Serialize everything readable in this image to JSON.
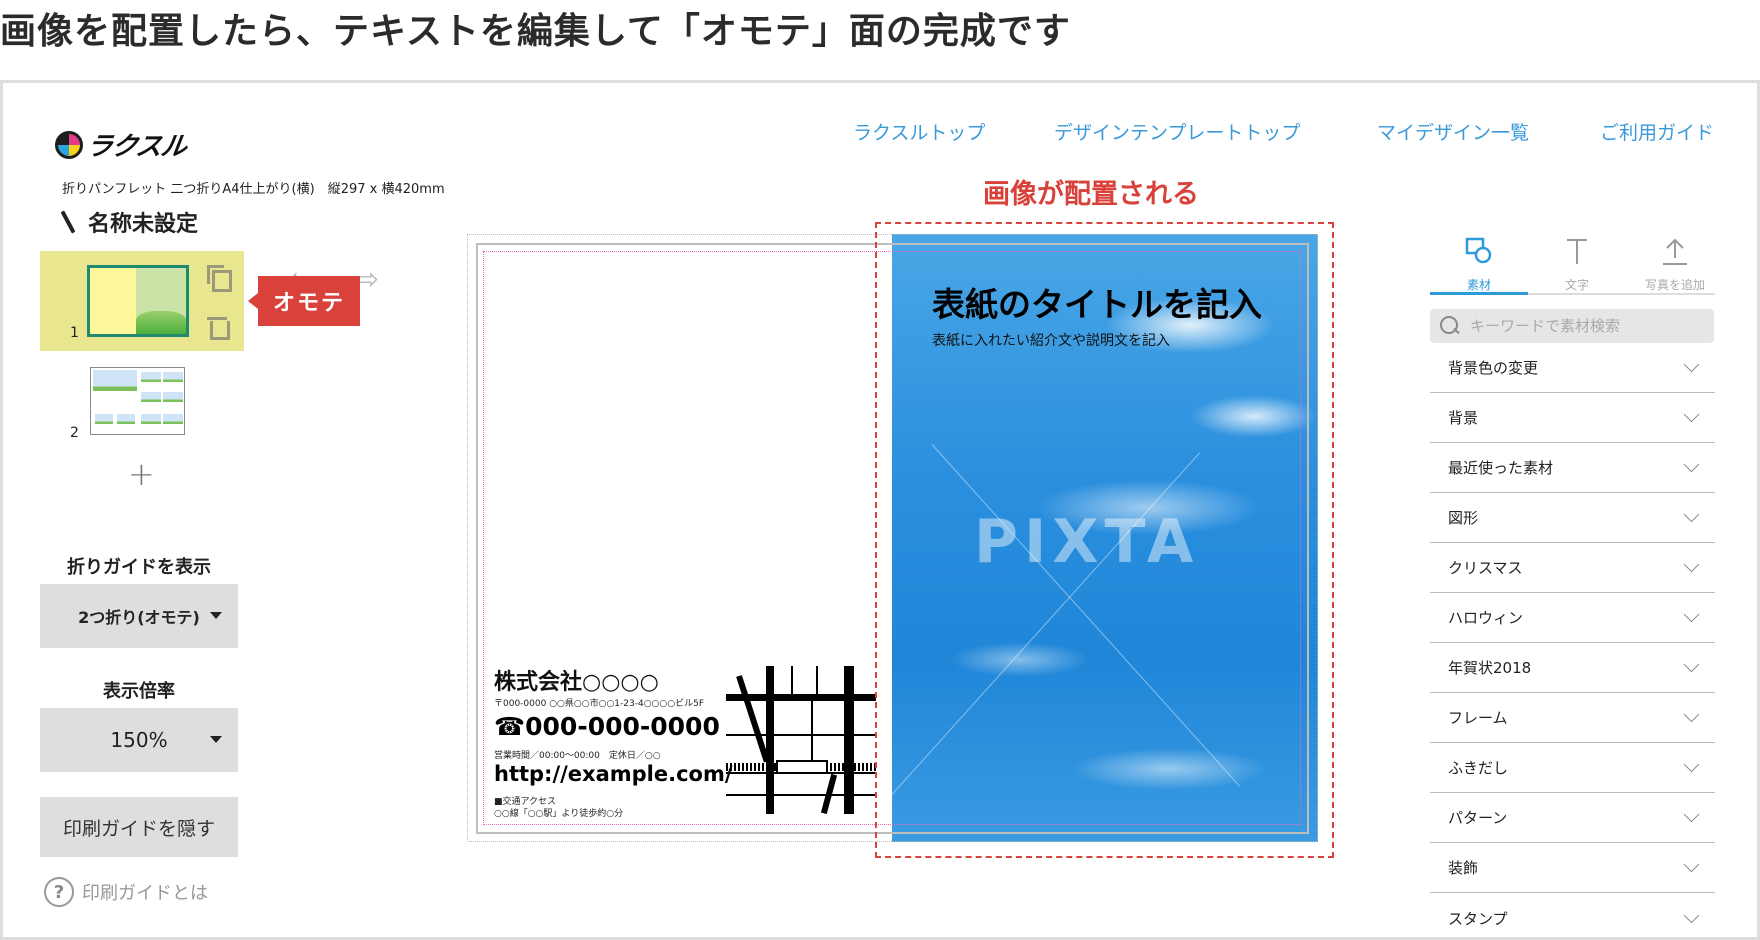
{
  "headline": "画像を配置したら、テキストを編集して「オモテ」面の完成です",
  "logo": {
    "icon": "raksul-logo-icon",
    "text": "ラクスル"
  },
  "product_info": "折りパンフレット 二つ折りA4仕上がり(横)　縦297 x 横420mm",
  "design_name": {
    "icon": "pencil-icon",
    "title": "名称未設定"
  },
  "pages": [
    {
      "number": "1",
      "selected": true,
      "actions": [
        "copy-icon",
        "trash-icon"
      ]
    },
    {
      "number": "2",
      "selected": false
    }
  ],
  "add_page": "+",
  "side_label": "オモテ",
  "undo_redo": {
    "undo": "undo-arrow-icon",
    "redo": "redo-arrow-icon"
  },
  "fold_guide": {
    "label": "折りガイドを表示",
    "value": "2つ折り(オモテ)"
  },
  "zoom": {
    "label": "表示倍率",
    "value": "150%"
  },
  "print_guide_button": "印刷ガイドを隠す",
  "help_link": {
    "icon": "question-icon",
    "text": "印刷ガイドとは"
  },
  "top_nav": [
    "ラクスルトップ",
    "デザインテンプレートトップ",
    "マイデザイン一覧",
    "ご利用ガイド"
  ],
  "annotation": "画像が配置される",
  "canvas": {
    "cover_title": "表紙のタイトルを記入",
    "cover_subtitle": "表紙に入れたい紹介文や説明文を記入",
    "watermark": "PIXTA",
    "company": "株式会社○○○○",
    "address": "〒000-0000 ○○県○○市○○1-23-4○○○○ビル5F",
    "phone": "☎000-000-0000",
    "hours": "営業時間／00:00〜00:00　定休日／○○",
    "url": "http://example.com/",
    "access_title": "■交通アクセス",
    "access_detail": "○○線「○○駅」より徒歩約○分"
  },
  "tools": {
    "tabs": [
      {
        "label": "素材",
        "icon": "shapes-icon",
        "active": true
      },
      {
        "label": "文字",
        "icon": "text-icon",
        "active": false
      },
      {
        "label": "写真を追加",
        "icon": "upload-icon",
        "active": false
      }
    ],
    "search_placeholder": "キーワードで素材検索",
    "categories": [
      "背景色の変更",
      "背景",
      "最近使った素材",
      "図形",
      "クリスマス",
      "ハロウィン",
      "年賀状2018",
      "フレーム",
      "ふきだし",
      "パターン",
      "装飾",
      "スタンプ"
    ]
  },
  "colors": {
    "accent_blue": "#2f9ad8",
    "annotation_red": "#d9423a",
    "selected_page": "#e9e690"
  }
}
